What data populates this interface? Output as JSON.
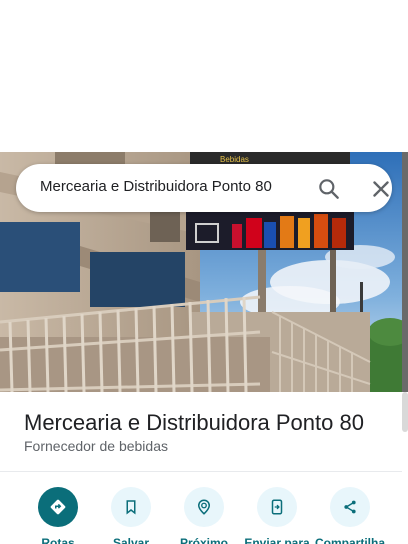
{
  "search": {
    "query": "Mercearia e Distribuidora Ponto 80",
    "search_icon": "search-icon",
    "close_icon": "close-icon"
  },
  "photo": {
    "sign_text": "Bebidas"
  },
  "place": {
    "title": "Mercearia e Distribuidora Ponto 80",
    "category": "Fornecedor de bebidas"
  },
  "actions": [
    {
      "label": "Rotas",
      "icon": "directions-icon"
    },
    {
      "label": "Salvar",
      "icon": "bookmark-icon"
    },
    {
      "label": "Próximo",
      "icon": "nearby-icon"
    },
    {
      "label": "Enviar para",
      "icon": "send-to-phone-icon"
    },
    {
      "label": "Compartilha",
      "icon": "share-icon"
    }
  ],
  "colors": {
    "accent": "#0b6e7a",
    "action_bg": "#e8f6fb",
    "title": "#202124",
    "subtitle": "#5f6368"
  }
}
